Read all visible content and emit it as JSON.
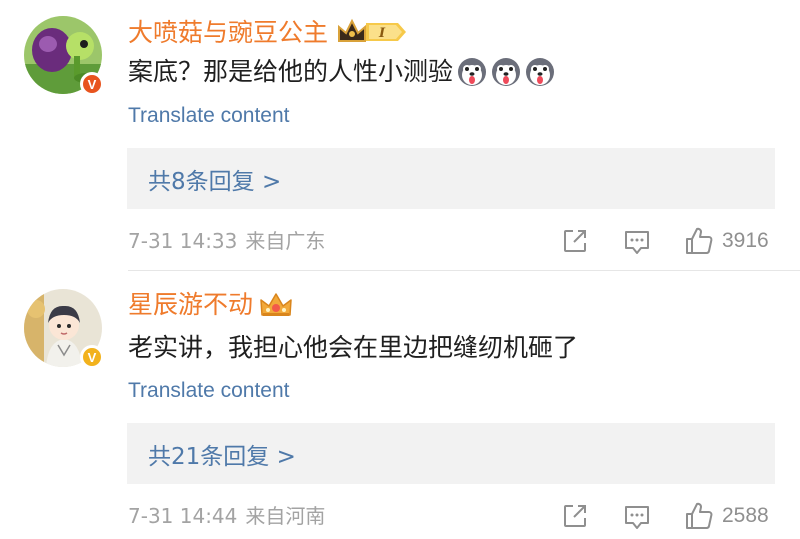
{
  "comments": [
    {
      "username": "大喷菇与豌豆公主",
      "level": "I",
      "text": "案底？那是给他的人性小测验",
      "emoji_icon": "dog-tongue-emoji-icon",
      "emoji_count": 3,
      "translate_label": "Translate content",
      "replies_label": "共8条回复 >",
      "date": "7-31 14:33",
      "source": "来自广东",
      "likes": "3916",
      "badge_color": "#e8541e",
      "name_color": "#ef7b2c"
    },
    {
      "username": "星辰游不动",
      "text": "老实讲，我担心他会在里边把缝纫机砸了",
      "translate_label": "Translate content",
      "replies_label": "共21条回复 >",
      "date": "7-31 14:44",
      "source": "来自河南",
      "likes": "2588",
      "badge_color": "#f2b21d",
      "name_color": "#ef7b2c"
    }
  ],
  "colors": {
    "link": "#4f79a9",
    "meta_text": "#a3a3a3",
    "reply_box_bg": "#f2f2f2"
  },
  "icons": [
    "share-icon",
    "comment-icon",
    "like-icon",
    "crown-icon",
    "verified-badge-icon"
  ]
}
